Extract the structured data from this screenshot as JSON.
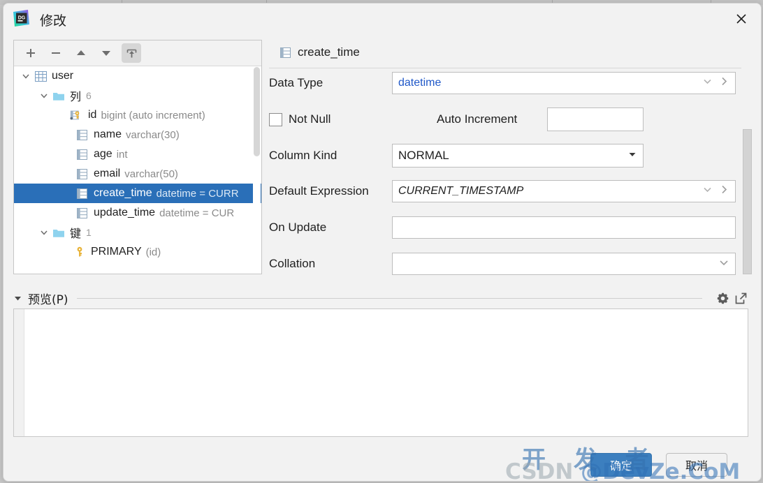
{
  "window": {
    "title": "修改",
    "app_icon": "datagrip-logo",
    "close_label": "✕"
  },
  "tree_toolbar": {
    "buttons": [
      {
        "name": "add-button",
        "icon": "plus-icon",
        "label": "+"
      },
      {
        "name": "remove-button",
        "icon": "minus-icon",
        "label": "−"
      },
      {
        "name": "move-up-button",
        "icon": "arrow-up-icon",
        "label": "▲"
      },
      {
        "name": "move-down-button",
        "icon": "arrow-down-icon",
        "label": "▼"
      },
      {
        "name": "submit-button",
        "icon": "export-up-icon",
        "label": "⇪",
        "selected": true
      }
    ]
  },
  "tree": {
    "items": [
      {
        "label": "user",
        "meta": "",
        "count": "",
        "icon": "table-icon",
        "indent": 0,
        "expanded": true,
        "selected": false
      },
      {
        "label": "列",
        "meta": "",
        "count": "6",
        "icon": "folder-icon",
        "indent": 1,
        "expanded": true,
        "selected": false
      },
      {
        "label": "id",
        "meta": "bigint (auto increment)",
        "count": "",
        "icon": "column-key-icon",
        "indent": 2,
        "expanded": null,
        "selected": false
      },
      {
        "label": "name",
        "meta": "varchar(30)",
        "count": "",
        "icon": "column-icon",
        "indent": 2,
        "expanded": null,
        "selected": false
      },
      {
        "label": "age",
        "meta": "int",
        "count": "",
        "icon": "column-icon",
        "indent": 2,
        "expanded": null,
        "selected": false
      },
      {
        "label": "email",
        "meta": "varchar(50)",
        "count": "",
        "icon": "column-icon",
        "indent": 2,
        "expanded": null,
        "selected": false
      },
      {
        "label": "create_time",
        "meta": "datetime = CURR",
        "count": "",
        "icon": "column-icon",
        "indent": 2,
        "expanded": null,
        "selected": true
      },
      {
        "label": "update_time",
        "meta": "datetime = CUR",
        "count": "",
        "icon": "column-icon",
        "indent": 2,
        "expanded": null,
        "selected": false
      },
      {
        "label": "键",
        "meta": "",
        "count": "1",
        "icon": "folder-icon",
        "indent": 1,
        "expanded": true,
        "selected": false
      },
      {
        "label": "PRIMARY",
        "meta": "(id)",
        "count": "",
        "icon": "key-icon",
        "indent": 2,
        "expanded": null,
        "selected": false
      }
    ]
  },
  "form": {
    "header": "create_time",
    "header_icon": "column-icon",
    "data_type": {
      "label": "Data Type",
      "value": "datetime"
    },
    "not_null": {
      "label": "Not Null",
      "checked": false
    },
    "auto_increment": {
      "label": "Auto Increment",
      "value": ""
    },
    "column_kind": {
      "label": "Column Kind",
      "value": "NORMAL"
    },
    "default_expression": {
      "label": "Default Expression",
      "value": "CURRENT_TIMESTAMP"
    },
    "on_update": {
      "label": "On Update",
      "value": ""
    },
    "collation": {
      "label": "Collation",
      "value": ""
    }
  },
  "preview": {
    "title": "预览(P)",
    "collapsed": false,
    "content": "",
    "settings_icon": "gear-icon",
    "popout_icon": "open-in-new-window-icon"
  },
  "footer": {
    "ok_label": "确定",
    "cancel_label": "取消"
  },
  "watermark": {
    "line1": "开 发 者",
    "line2_prefix": "CSDN ",
    "line2_main": "@DevZe.CoM"
  },
  "colors": {
    "selection_blue": "#2a6fb8",
    "primary_button": "#3c7fbf",
    "value_blue": "#2058c8",
    "dialog_bg": "#f2f2f2",
    "panel_bg": "#ffffff"
  }
}
